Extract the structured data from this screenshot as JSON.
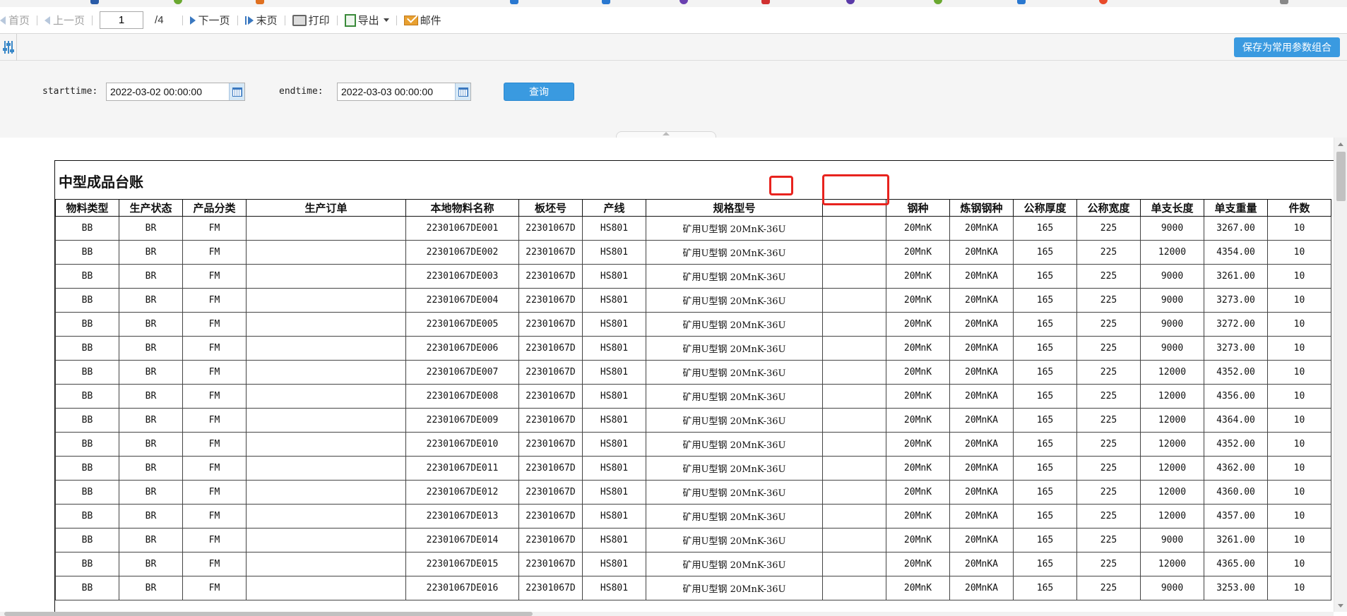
{
  "toolbar": {
    "first_page": "首页",
    "prev_page": "上一页",
    "current_page": "1",
    "total_pages": "/4",
    "next_page": "下一页",
    "last_page": "末页",
    "print": "打印",
    "export": "导出",
    "mail": "邮件"
  },
  "params": {
    "save_button": "保存为常用参数组合",
    "starttime_label": "starttime:",
    "starttime_value": "2022-03-02 00:00:00",
    "endtime_label": "endtime:",
    "endtime_value": "2022-03-03 00:00:00",
    "query_button": "查询"
  },
  "report": {
    "title": "中型成品台账",
    "columns": [
      "物料类型",
      "生产状态",
      "产品分类",
      "生产订单",
      "本地物料名称",
      "板坯号",
      "产线",
      "规格型号",
      "",
      "钢种",
      "炼钢钢种",
      "公称厚度",
      "公称宽度",
      "单支长度",
      "单支重量",
      "件数"
    ],
    "rows": [
      [
        "BB",
        "BR",
        "FM",
        "",
        "22301067DE001",
        "22301067D",
        "HS801",
        "矿用U型钢 20MnK-36U",
        "",
        "20MnK",
        "20MnKA",
        "165",
        "225",
        "9000",
        "3267.00",
        "10"
      ],
      [
        "BB",
        "BR",
        "FM",
        "",
        "22301067DE002",
        "22301067D",
        "HS801",
        "矿用U型钢 20MnK-36U",
        "",
        "20MnK",
        "20MnKA",
        "165",
        "225",
        "12000",
        "4354.00",
        "10"
      ],
      [
        "BB",
        "BR",
        "FM",
        "",
        "22301067DE003",
        "22301067D",
        "HS801",
        "矿用U型钢 20MnK-36U",
        "",
        "20MnK",
        "20MnKA",
        "165",
        "225",
        "9000",
        "3261.00",
        "10"
      ],
      [
        "BB",
        "BR",
        "FM",
        "",
        "22301067DE004",
        "22301067D",
        "HS801",
        "矿用U型钢 20MnK-36U",
        "",
        "20MnK",
        "20MnKA",
        "165",
        "225",
        "9000",
        "3273.00",
        "10"
      ],
      [
        "BB",
        "BR",
        "FM",
        "",
        "22301067DE005",
        "22301067D",
        "HS801",
        "矿用U型钢 20MnK-36U",
        "",
        "20MnK",
        "20MnKA",
        "165",
        "225",
        "9000",
        "3272.00",
        "10"
      ],
      [
        "BB",
        "BR",
        "FM",
        "",
        "22301067DE006",
        "22301067D",
        "HS801",
        "矿用U型钢 20MnK-36U",
        "",
        "20MnK",
        "20MnKA",
        "165",
        "225",
        "9000",
        "3273.00",
        "10"
      ],
      [
        "BB",
        "BR",
        "FM",
        "",
        "22301067DE007",
        "22301067D",
        "HS801",
        "矿用U型钢 20MnK-36U",
        "",
        "20MnK",
        "20MnKA",
        "165",
        "225",
        "12000",
        "4352.00",
        "10"
      ],
      [
        "BB",
        "BR",
        "FM",
        "",
        "22301067DE008",
        "22301067D",
        "HS801",
        "矿用U型钢 20MnK-36U",
        "",
        "20MnK",
        "20MnKA",
        "165",
        "225",
        "12000",
        "4356.00",
        "10"
      ],
      [
        "BB",
        "BR",
        "FM",
        "",
        "22301067DE009",
        "22301067D",
        "HS801",
        "矿用U型钢 20MnK-36U",
        "",
        "20MnK",
        "20MnKA",
        "165",
        "225",
        "12000",
        "4364.00",
        "10"
      ],
      [
        "BB",
        "BR",
        "FM",
        "",
        "22301067DE010",
        "22301067D",
        "HS801",
        "矿用U型钢 20MnK-36U",
        "",
        "20MnK",
        "20MnKA",
        "165",
        "225",
        "12000",
        "4352.00",
        "10"
      ],
      [
        "BB",
        "BR",
        "FM",
        "",
        "22301067DE011",
        "22301067D",
        "HS801",
        "矿用U型钢 20MnK-36U",
        "",
        "20MnK",
        "20MnKA",
        "165",
        "225",
        "12000",
        "4362.00",
        "10"
      ],
      [
        "BB",
        "BR",
        "FM",
        "",
        "22301067DE012",
        "22301067D",
        "HS801",
        "矿用U型钢 20MnK-36U",
        "",
        "20MnK",
        "20MnKA",
        "165",
        "225",
        "12000",
        "4360.00",
        "10"
      ],
      [
        "BB",
        "BR",
        "FM",
        "",
        "22301067DE013",
        "22301067D",
        "HS801",
        "矿用U型钢 20MnK-36U",
        "",
        "20MnK",
        "20MnKA",
        "165",
        "225",
        "12000",
        "4357.00",
        "10"
      ],
      [
        "BB",
        "BR",
        "FM",
        "",
        "22301067DE014",
        "22301067D",
        "HS801",
        "矿用U型钢 20MnK-36U",
        "",
        "20MnK",
        "20MnKA",
        "165",
        "225",
        "9000",
        "3261.00",
        "10"
      ],
      [
        "BB",
        "BR",
        "FM",
        "",
        "22301067DE015",
        "22301067D",
        "HS801",
        "矿用U型钢 20MnK-36U",
        "",
        "20MnK",
        "20MnKA",
        "165",
        "225",
        "12000",
        "4365.00",
        "10"
      ],
      [
        "BB",
        "BR",
        "FM",
        "",
        "22301067DE016",
        "22301067D",
        "HS801",
        "矿用U型钢 20MnK-36U",
        "",
        "20MnK",
        "20MnKA",
        "165",
        "225",
        "9000",
        "3253.00",
        "10"
      ]
    ]
  },
  "colors": {
    "accent": "#3a9ae0",
    "highlight": "#e8231e",
    "panel_bg": "#f5f5f5"
  },
  "icons": [
    "prev-arrow-icon",
    "next-arrow-icon",
    "last-page-icon",
    "printer-icon",
    "export-icon",
    "mail-icon",
    "calendar-icon",
    "param-settings-icon"
  ]
}
